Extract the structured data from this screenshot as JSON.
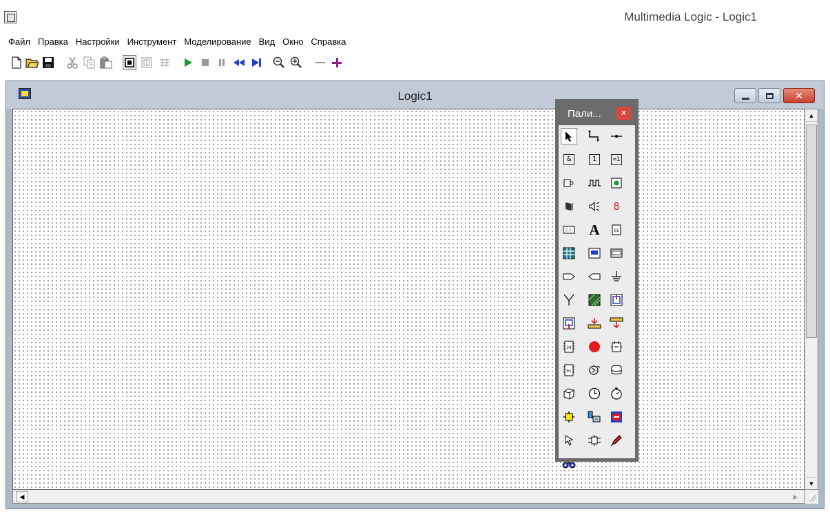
{
  "app": {
    "title": "Multimedia Logic - Logic1"
  },
  "menu": [
    "Файл",
    "Правка",
    "Настройки",
    "Инструмент",
    "Моделирование",
    "Вид",
    "Окно",
    "Справка"
  ],
  "toolbar": [
    {
      "name": "new-file-icon",
      "glyph": "🗋"
    },
    {
      "name": "open-folder-icon",
      "glyph": ""
    },
    {
      "name": "save-disk-icon",
      "glyph": ""
    },
    {
      "name": "cut-scissors-icon",
      "glyph": "✂"
    },
    {
      "name": "copy-icon",
      "glyph": ""
    },
    {
      "name": "paste-icon",
      "glyph": ""
    },
    {
      "name": "draw-mode-icon",
      "glyph": ""
    },
    {
      "name": "grid-mode-icon",
      "glyph": ""
    },
    {
      "name": "net-mode-icon",
      "glyph": ""
    },
    {
      "name": "run-play-icon",
      "glyph": "▶"
    },
    {
      "name": "stop-icon",
      "glyph": "■"
    },
    {
      "name": "pause-icon",
      "glyph": "❚❚"
    },
    {
      "name": "rewind-icon",
      "glyph": "◀◀"
    },
    {
      "name": "step-forward-icon",
      "glyph": "▶❙"
    },
    {
      "name": "zoom-out-icon",
      "glyph": ""
    },
    {
      "name": "zoom-in-icon",
      "glyph": ""
    },
    {
      "name": "line-icon",
      "glyph": "—"
    },
    {
      "name": "plus-icon",
      "glyph": "+"
    }
  ],
  "document": {
    "title": "Logic1"
  },
  "palette": {
    "title": "Пали...",
    "close": "×"
  }
}
